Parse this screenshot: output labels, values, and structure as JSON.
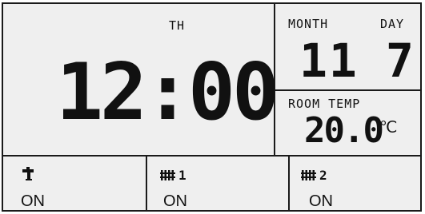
{
  "clock": {
    "weekday": "TH",
    "time": "12:00"
  },
  "date": {
    "month_label": "MONTH",
    "day_label": "DAY",
    "month_value": "11",
    "day_value": "7"
  },
  "room": {
    "label": "ROOM TEMP",
    "value": "20.0",
    "unit": "℃"
  },
  "zones": [
    {
      "icon": "faucet-icon",
      "number": "",
      "status": "ON"
    },
    {
      "icon": "radiator-icon",
      "number": "1",
      "status": "ON"
    },
    {
      "icon": "radiator-icon",
      "number": "2",
      "status": "ON"
    }
  ]
}
